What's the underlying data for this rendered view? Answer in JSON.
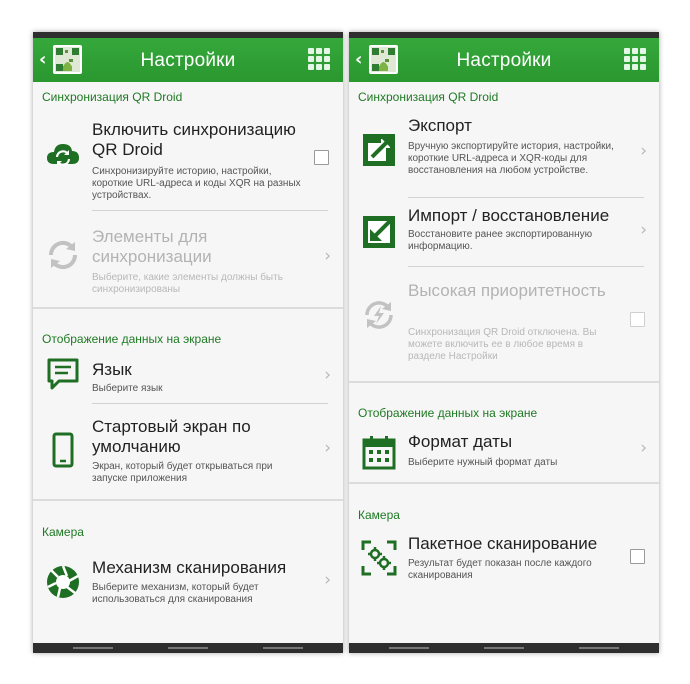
{
  "screens": [
    {
      "header": {
        "back": "‹",
        "title": "Настройки"
      },
      "sections": [
        {
          "header": "Синхронизация QR Droid"
        },
        {
          "header": "Отображение данных на экране"
        },
        {
          "header": "Камера"
        }
      ],
      "items": [
        {
          "title": "Включить синхронизацию QR Droid",
          "summary": "Синхронизируйте историю, настройки, короткие URL-адреса и коды XQR на разных устройствах.",
          "control": "checkbox",
          "checked": false,
          "enabled": true,
          "icon": "cloud-sync-icon"
        },
        {
          "title": "Элементы для синхронизации",
          "summary": "Выберите, какие элементы должны быть синхронизированы",
          "control": "chevron",
          "enabled": false,
          "icon": "sync-arrows-icon"
        },
        {
          "title": "Язык",
          "summary": "Выберите язык",
          "control": "chevron",
          "enabled": true,
          "icon": "speech-bubble-icon"
        },
        {
          "title": "Стартовый экран по умолчанию",
          "summary": "Экран, который будет открываться при запуске приложения",
          "control": "chevron",
          "enabled": true,
          "icon": "smartphone-icon"
        },
        {
          "title": "Механизм сканирования",
          "summary": "Выберите механизм, который будет использоваться для сканирования",
          "control": "chevron",
          "enabled": true,
          "icon": "camera-shutter-icon"
        }
      ]
    },
    {
      "header": {
        "back": "‹",
        "title": "Настройки"
      },
      "sections": [
        {
          "header": "Синхронизация QR Droid"
        },
        {
          "header": "Отображение данных на экране"
        },
        {
          "header": "Камера"
        }
      ],
      "items": [
        {
          "title": "Экспорт",
          "summary": "Вручную экспортируйте история, настройки, короткие URL-адреса и XQR-коды для восстановления на любом устройстве.",
          "control": "chevron",
          "enabled": true,
          "icon": "export-icon"
        },
        {
          "title": "Импорт / восстановление",
          "summary": "Восстановите ранее экспортированную информацию.",
          "control": "chevron",
          "enabled": true,
          "icon": "import-icon"
        },
        {
          "title": "Высокая приоритетность",
          "summary": "Синхронизация QR Droid отключена. Вы можете включить ее в любое время в разделе Настройки",
          "control": "checkbox",
          "checked": false,
          "enabled": false,
          "icon": "priority-sync-icon"
        },
        {
          "title": "Формат даты",
          "summary": "Выберите нужный формат даты",
          "control": "chevron",
          "enabled": true,
          "icon": "calendar-icon"
        },
        {
          "title": "Пакетное сканирование",
          "summary": "Результат будет показан после каждого сканирования",
          "control": "checkbox",
          "checked": false,
          "enabled": true,
          "icon": "batch-scan-icon"
        }
      ]
    }
  ],
  "colors": {
    "accent": "#2e9e33",
    "section_header": "#1f7a24",
    "icon": "#1e6e23"
  },
  "chevron": "›"
}
